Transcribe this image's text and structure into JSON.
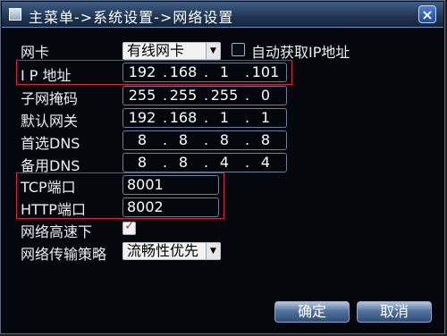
{
  "window": {
    "title": "主菜单->系统设置->网络设置",
    "close_glyph": "×"
  },
  "form": {
    "nic": {
      "label": "网卡",
      "value": "有线网卡"
    },
    "auto_ip": {
      "label": "自动获取IP地址",
      "checked": false
    },
    "ip": {
      "label": "I P 地址",
      "parts": [
        "192",
        "168",
        "1",
        "101"
      ]
    },
    "subnet": {
      "label": "子网掩码",
      "parts": [
        "255",
        "255",
        "255",
        "0"
      ]
    },
    "gateway": {
      "label": "默认网关",
      "parts": [
        "192",
        "168",
        "1",
        "1"
      ]
    },
    "dns1": {
      "label": "首选DNS",
      "parts": [
        "8",
        "8",
        "8",
        "8"
      ]
    },
    "dns2": {
      "label": "备用DNS",
      "parts": [
        "8",
        "8",
        "4",
        "4"
      ]
    },
    "tcp_port": {
      "label": "TCP端口",
      "value": "8001"
    },
    "http_port": {
      "label": "HTTP端口",
      "value": "8002"
    },
    "high_speed": {
      "label": "网络高速下",
      "checked": true
    },
    "strategy": {
      "label": "网络传输策略",
      "value": "流畅性优先"
    }
  },
  "buttons": {
    "ok": "确定",
    "cancel": "取消"
  },
  "colors": {
    "highlight": "#d7263d",
    "titlebar": "#1f3553",
    "background": "#05070c"
  }
}
